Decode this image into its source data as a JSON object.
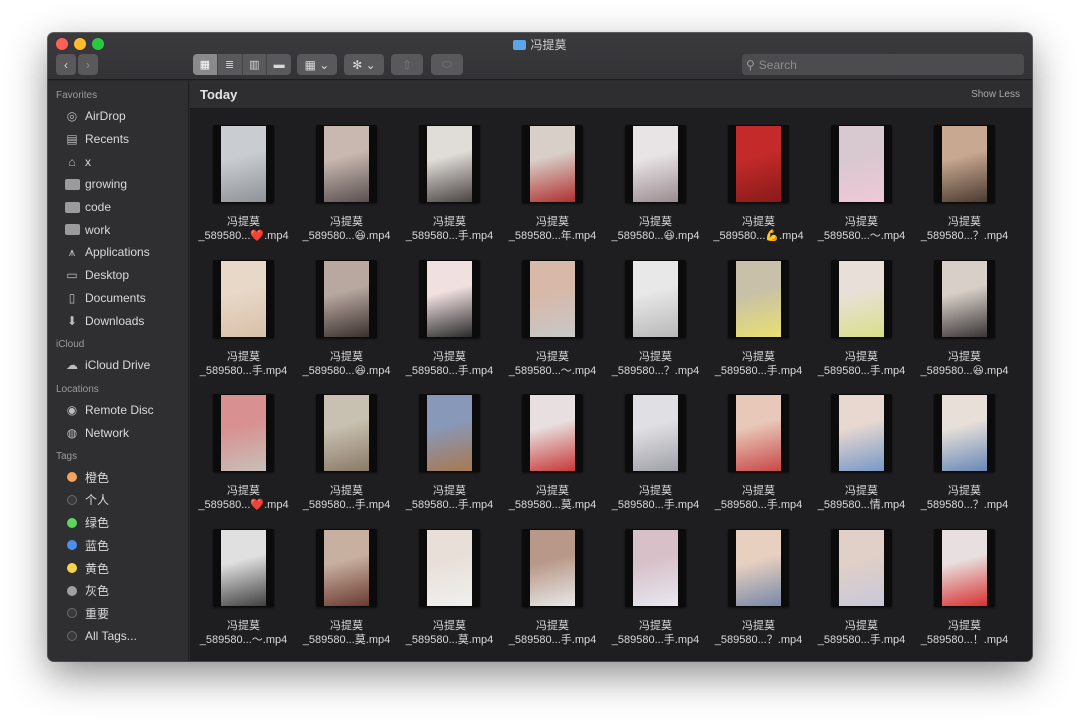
{
  "window": {
    "title": "冯提莫"
  },
  "toolbar": {
    "back_label": "‹",
    "forward_label": "›",
    "view_icons": [
      "▦",
      "≣",
      "▥",
      "▬"
    ],
    "group_label": "▦ ⌄",
    "action_label": "✻ ⌄",
    "share_label": "⇧",
    "tag_label": "⬭"
  },
  "search": {
    "placeholder": "Search"
  },
  "sidebar": {
    "sections": [
      {
        "header": "Favorites",
        "items": [
          {
            "label": "AirDrop",
            "icon": "airdrop-icon"
          },
          {
            "label": "Recents",
            "icon": "recents-icon"
          },
          {
            "label": "x",
            "icon": "home-icon"
          },
          {
            "label": "growing",
            "icon": "folder-icon"
          },
          {
            "label": "code",
            "icon": "folder-icon"
          },
          {
            "label": "work",
            "icon": "folder-icon"
          },
          {
            "label": "Applications",
            "icon": "applications-icon"
          },
          {
            "label": "Desktop",
            "icon": "desktop-icon"
          },
          {
            "label": "Documents",
            "icon": "documents-icon"
          },
          {
            "label": "Downloads",
            "icon": "downloads-icon"
          }
        ]
      },
      {
        "header": "iCloud",
        "items": [
          {
            "label": "iCloud Drive",
            "icon": "cloud-icon"
          }
        ]
      },
      {
        "header": "Locations",
        "items": [
          {
            "label": "Remote Disc",
            "icon": "disc-icon"
          },
          {
            "label": "Network",
            "icon": "network-icon"
          }
        ]
      },
      {
        "header": "Tags",
        "items": [
          {
            "label": "橙色",
            "icon": "tag-icon",
            "color": "#f5a35a"
          },
          {
            "label": "个人",
            "icon": "tag-icon",
            "color": "#3a393c"
          },
          {
            "label": "绿色",
            "icon": "tag-icon",
            "color": "#5cd65c"
          },
          {
            "label": "蓝色",
            "icon": "tag-icon",
            "color": "#4b8ff0"
          },
          {
            "label": "黄色",
            "icon": "tag-icon",
            "color": "#f5d64a"
          },
          {
            "label": "灰色",
            "icon": "tag-icon",
            "color": "#a0a0a3"
          },
          {
            "label": "重要",
            "icon": "tag-icon",
            "color": "#3a393c"
          },
          {
            "label": "All Tags...",
            "icon": "all-tags-icon",
            "color": "#3a393c"
          }
        ]
      }
    ]
  },
  "content": {
    "section_title": "Today",
    "show_less": "Show Less",
    "files": [
      {
        "line1": "冯提莫",
        "line2": "_589580...❤️.mp4",
        "colors": [
          "#c9ccd0",
          "#8f9397"
        ]
      },
      {
        "line1": "冯提莫",
        "line2": "_589580...😆.mp4",
        "colors": [
          "#c8b8b0",
          "#5a5050"
        ]
      },
      {
        "line1": "冯提莫",
        "line2": "_589580...手.mp4",
        "colors": [
          "#e0dcd8",
          "#4a4442"
        ]
      },
      {
        "line1": "冯提莫",
        "line2": "_589580...年.mp4",
        "colors": [
          "#d8cfc8",
          "#b03030"
        ]
      },
      {
        "line1": "冯提莫",
        "line2": "_589580...😆.mp4",
        "colors": [
          "#e8e4e6",
          "#9a8c90"
        ]
      },
      {
        "line1": "冯提莫",
        "line2": "_589580...💪.mp4",
        "colors": [
          "#c42a2a",
          "#8a1a1a"
        ]
      },
      {
        "line1": "冯提莫",
        "line2": "_589580...～.mp4",
        "colors": [
          "#d8c8d0",
          "#f0c8d8"
        ]
      },
      {
        "line1": "冯提莫",
        "line2": "_589580...？.mp4",
        "colors": [
          "#c8a890",
          "#4a3a30"
        ]
      },
      {
        "line1": "冯提莫",
        "line2": "_589580...手.mp4",
        "colors": [
          "#e8d8c8",
          "#d8c0a8"
        ]
      },
      {
        "line1": "冯提莫",
        "line2": "_589580...😆.mp4",
        "colors": [
          "#b8a8a0",
          "#3a302c"
        ]
      },
      {
        "line1": "冯提莫",
        "line2": "_589580...手.mp4",
        "colors": [
          "#f0e0e0",
          "#2a2a2a"
        ]
      },
      {
        "line1": "冯提莫",
        "line2": "_589580...～.mp4",
        "colors": [
          "#d8b8a8",
          "#c8c8c8"
        ]
      },
      {
        "line1": "冯提莫",
        "line2": "_589580...？.mp4",
        "colors": [
          "#e8e8e8",
          "#b8b8b8"
        ]
      },
      {
        "line1": "冯提莫",
        "line2": "_589580...手.mp4",
        "colors": [
          "#c8c0a8",
          "#e8e070"
        ]
      },
      {
        "line1": "冯提莫",
        "line2": "_589580...手.mp4",
        "colors": [
          "#e8e0d8",
          "#d8e088"
        ]
      },
      {
        "line1": "冯提莫",
        "line2": "_589580...😆.mp4",
        "colors": [
          "#d8d0c8",
          "#3a3436"
        ]
      },
      {
        "line1": "冯提莫",
        "line2": "_589580...❤️.mp4",
        "colors": [
          "#d89090",
          "#c8c0b8"
        ]
      },
      {
        "line1": "冯提莫",
        "line2": "_589580...手.mp4",
        "colors": [
          "#c8c0b0",
          "#8a7a68"
        ]
      },
      {
        "line1": "冯提莫",
        "line2": "_589580...手.mp4",
        "colors": [
          "#8898b8",
          "#a87850"
        ]
      },
      {
        "line1": "冯提莫",
        "line2": "_589580...莫.mp4",
        "colors": [
          "#e8e0e0",
          "#c83838"
        ]
      },
      {
        "line1": "冯提莫",
        "line2": "_589580...手.mp4",
        "colors": [
          "#e0e0e4",
          "#a0a0a8"
        ]
      },
      {
        "line1": "冯提莫",
        "line2": "_589580...手.mp4",
        "colors": [
          "#e8c8b8",
          "#c84848"
        ]
      },
      {
        "line1": "冯提莫",
        "line2": "_589580...情.mp4",
        "colors": [
          "#e8d8d0",
          "#7898c8"
        ]
      },
      {
        "line1": "冯提莫",
        "line2": "_589580...？.mp4",
        "colors": [
          "#e8e0d8",
          "#6888b8"
        ]
      },
      {
        "line1": "冯提莫",
        "line2": "_589580...～.mp4",
        "colors": [
          "#e0e0e0",
          "#404040"
        ]
      },
      {
        "line1": "冯提莫",
        "line2": "_589580...莫.mp4",
        "colors": [
          "#c8b0a0",
          "#6a3a30"
        ]
      },
      {
        "line1": "冯提莫",
        "line2": "_589580...莫.mp4",
        "colors": [
          "#e8e0d8",
          "#f0f0f0"
        ]
      },
      {
        "line1": "冯提莫",
        "line2": "_589580...手.mp4",
        "colors": [
          "#b89888",
          "#e8e8e8"
        ]
      },
      {
        "line1": "冯提莫",
        "line2": "_589580...手.mp4",
        "colors": [
          "#d8c0c8",
          "#e8e8f0"
        ]
      },
      {
        "line1": "冯提莫",
        "line2": "_589580...？.mp4",
        "colors": [
          "#e8d0c0",
          "#7888a8"
        ]
      },
      {
        "line1": "冯提莫",
        "line2": "_589580...手.mp4",
        "colors": [
          "#e0d0c8",
          "#c8c8d8"
        ]
      },
      {
        "line1": "冯提莫",
        "line2": "_589580...！.mp4",
        "colors": [
          "#e8e0e0",
          "#d83030"
        ]
      }
    ]
  }
}
